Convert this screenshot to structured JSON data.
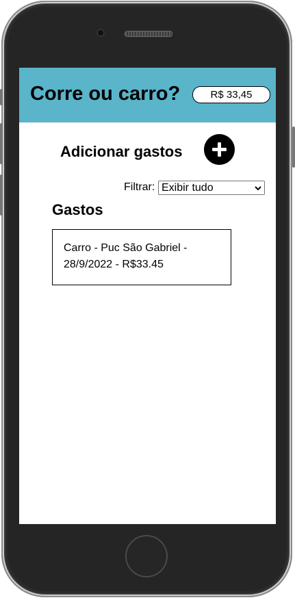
{
  "header": {
    "title": "Corre ou carro?",
    "balance": "R$ 33,45",
    "background_color": "#5ab4ca"
  },
  "add_section": {
    "label": "Adicionar gastos",
    "button_icon": "plus-icon"
  },
  "filter": {
    "label": "Filtrar:",
    "selected": "Exibir tudo",
    "icon": "chevron-down-icon"
  },
  "expenses": {
    "title": "Gastos",
    "items": [
      {
        "text": "Carro - Puc São Gabriel - 28/9/2022 - R$33.45"
      }
    ]
  }
}
